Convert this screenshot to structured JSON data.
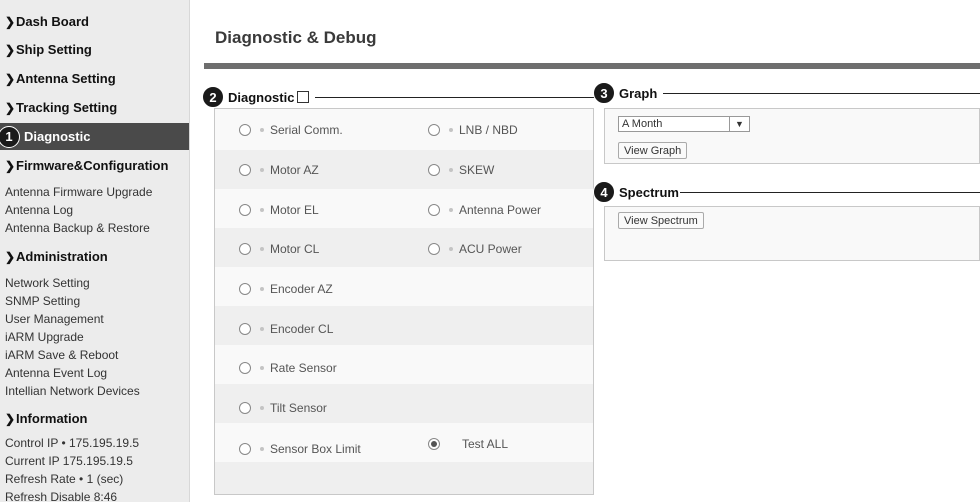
{
  "sidebar": {
    "dash_board": "Dash Board",
    "ship_setting": "Ship Setting",
    "antenna_setting": "Antenna Setting",
    "tracking_setting": "Tracking Setting",
    "diagnostic": "Diagnostic",
    "diagnostic_badge": "1",
    "firmware": "Firmware&Configuration",
    "firmware_items": [
      "Antenna Firmware Upgrade",
      "Antenna Log",
      "Antenna Backup & Restore"
    ],
    "administration": "Administration",
    "admin_items": [
      "Network Setting",
      "SNMP Setting",
      "User Management",
      "iARM Upgrade",
      "iARM Save & Reboot",
      "Antenna Event Log",
      "Intellian Network Devices"
    ],
    "information": "Information",
    "info_items": [
      "Control IP • 175.195.19.5",
      "Current IP  175.195.19.5",
      "Refresh Rate •   1 (sec)",
      "Refresh Disable   8:46"
    ]
  },
  "main": {
    "title": "Diagnostic & Debug",
    "diagnostic": {
      "badge": "2",
      "label": "Diagnostic",
      "left": [
        "Serial Comm.",
        "Motor AZ",
        "Motor EL",
        "Motor CL",
        "Encoder AZ",
        "Encoder CL",
        "Rate Sensor",
        "Tilt Sensor",
        "Sensor Box Limit"
      ],
      "right": [
        "LNB / NBD",
        "SKEW",
        "Antenna Power",
        "ACU Power"
      ],
      "test_all": "Test ALL"
    },
    "graph": {
      "badge": "3",
      "label": "Graph",
      "period": "A Month",
      "button": "View Graph"
    },
    "spectrum": {
      "badge": "4",
      "label": "Spectrum",
      "button": "View Spectrum"
    }
  }
}
